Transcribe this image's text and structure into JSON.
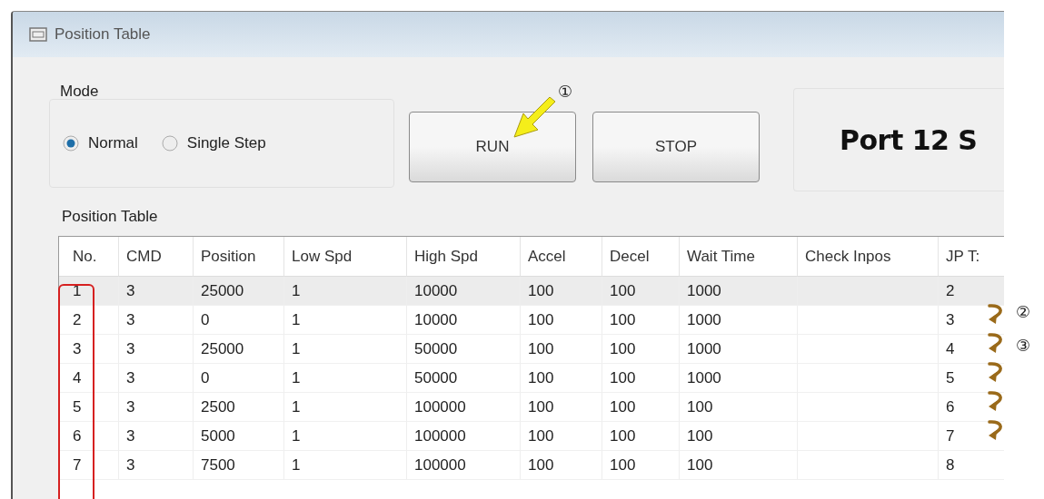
{
  "window": {
    "title": "Position Table"
  },
  "mode": {
    "label": "Mode",
    "options": [
      {
        "label": "Normal",
        "selected": true
      },
      {
        "label": "Single Step",
        "selected": false
      }
    ]
  },
  "buttons": [
    {
      "label": "RUN"
    },
    {
      "label": "STOP"
    }
  ],
  "port_status": "Port 12 S",
  "table": {
    "label": "Position Table",
    "columns": [
      "No.",
      "CMD",
      "Position",
      "Low Spd",
      "High Spd",
      "Accel",
      "Decel",
      "Wait Time",
      "Check Inpos",
      "JP T:"
    ],
    "rows": [
      {
        "selected": true,
        "cells": [
          "1",
          "3",
          "25000",
          "1",
          "10000",
          "100",
          "100",
          "1000",
          "",
          "2"
        ]
      },
      {
        "selected": false,
        "cells": [
          "2",
          "3",
          "0",
          "1",
          "10000",
          "100",
          "100",
          "1000",
          "",
          "3"
        ]
      },
      {
        "selected": false,
        "cells": [
          "3",
          "3",
          "25000",
          "1",
          "50000",
          "100",
          "100",
          "1000",
          "",
          "4"
        ]
      },
      {
        "selected": false,
        "cells": [
          "4",
          "3",
          "0",
          "1",
          "50000",
          "100",
          "100",
          "1000",
          "",
          "5"
        ]
      },
      {
        "selected": false,
        "cells": [
          "5",
          "3",
          "2500",
          "1",
          "100000",
          "100",
          "100",
          "100",
          "",
          "6"
        ]
      },
      {
        "selected": false,
        "cells": [
          "6",
          "3",
          "5000",
          "1",
          "100000",
          "100",
          "100",
          "100",
          "",
          "7"
        ]
      },
      {
        "selected": false,
        "cells": [
          "7",
          "3",
          "7500",
          "1",
          "100000",
          "100",
          "100",
          "100",
          "",
          "8"
        ]
      }
    ]
  },
  "annotations": [
    {
      "kind": "box"
    },
    {
      "kind": "pointer",
      "label": "①"
    },
    {
      "kind": "curl",
      "label": "②"
    },
    {
      "kind": "curl",
      "label": "③"
    },
    {
      "kind": "curl"
    },
    {
      "kind": "curl"
    },
    {
      "kind": "curl"
    }
  ]
}
